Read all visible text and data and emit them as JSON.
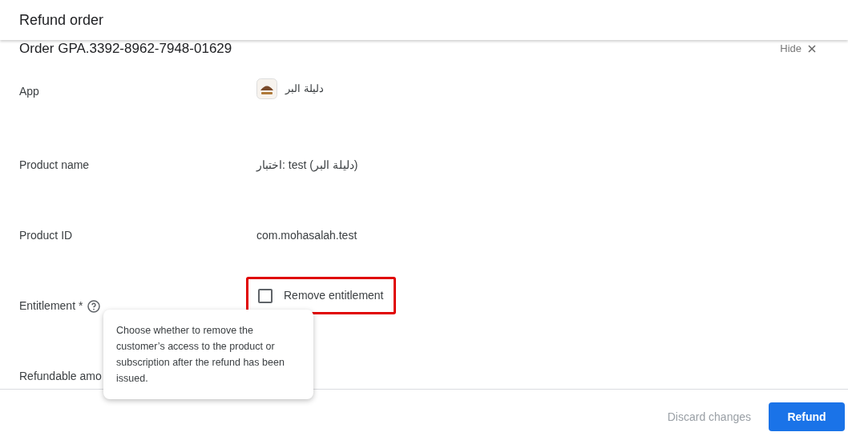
{
  "dialog": {
    "title": "Refund order"
  },
  "order": {
    "label": "Order GPA.3392-8962-7948-01629",
    "hide_link": "Hide"
  },
  "fields": [
    {
      "kind": "app",
      "label": "App",
      "value": "دليلة البر"
    },
    {
      "kind": "text",
      "label": "Product name",
      "value": "اختبار: test (دليلة البر)"
    },
    {
      "kind": "text",
      "label": "Product ID",
      "value": "com.mohasalah.test"
    },
    {
      "kind": "checkbox",
      "label": "Entitlement *",
      "value": "Remove entitlement",
      "checked": false,
      "highlighted": true
    },
    {
      "kind": "text",
      "label": "Refundable amo"
    }
  ],
  "tooltip": {
    "text": "Choose whether to remove the customer’s access to the product or subscription after the refund has been issued."
  },
  "buttons": [
    {
      "label": "Discard changes",
      "kind": "text",
      "disabled": true
    },
    {
      "label": "Refund",
      "kind": "primary",
      "disabled": false
    }
  ]
}
